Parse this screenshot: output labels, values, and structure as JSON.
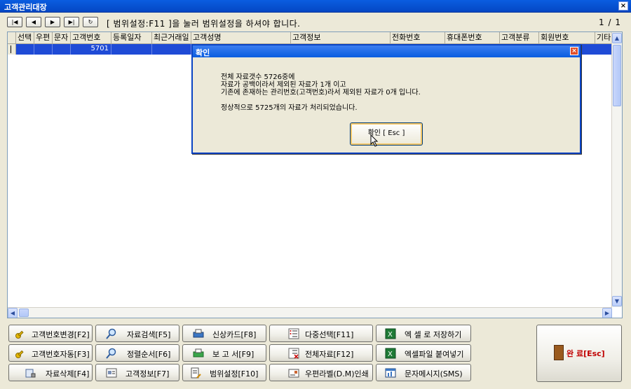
{
  "window": {
    "title": "고객관리대장",
    "close_glyph": "×"
  },
  "nav": {
    "buttons": [
      {
        "name": "first-record-button",
        "glyph": "|◀"
      },
      {
        "name": "prev-record-button",
        "glyph": "◀"
      },
      {
        "name": "next-record-button",
        "glyph": "▶"
      },
      {
        "name": "last-record-button",
        "glyph": "▶|"
      },
      {
        "name": "refresh-button",
        "glyph": "↻"
      }
    ],
    "hint": "[ 범위설정:F11 ]을 눌러 범위설정을 하셔야 합니다.",
    "page_count": "1 / 1"
  },
  "grid": {
    "columns": [
      "선택",
      "우편",
      "문자",
      "고객번호",
      "등록일자",
      "최근거래일",
      "고객성명",
      "고객정보",
      "전화번호",
      "휴대폰번호",
      "고객분류",
      "회원번호",
      "기타"
    ],
    "rows": [
      {
        "customer_no": "5701"
      }
    ]
  },
  "dialog": {
    "title": "확인",
    "close_glyph": "×",
    "lines": [
      "전체 자료갯수 5726중에",
      "자료가 공백이라서 제외된 자료가 1개 이고",
      "기존에 존재하는 관리번호(고객번호)라서 제외된 자료가 0개 입니다.",
      "정상적으로 5725개의 자료가 처리되었습니다."
    ],
    "ok_label": "확인 [ Esc ]"
  },
  "buttons": {
    "change_no": "고객번호변경[F2]",
    "search": "자료검색[F5]",
    "card": "신상카드[F8]",
    "multi_select": "다중선택[F11]",
    "excel_save": "엑 셀 로 저장하기",
    "auto_no": "고객번호자동[F3]",
    "sort": "정렬순서[F6]",
    "report": "보 고 서[F9]",
    "all_data": "전체자료[F12]",
    "excel_paste": "엑셀파일 붙여넣기",
    "delete": "자료삭제[F4]",
    "info": "고객정보[F7]",
    "range": "범위설정[F10]",
    "label_print": "우편라벨(D.M)인쇄",
    "sms": "문자메시지(SMS)",
    "done": "완 료[Esc]"
  },
  "icons": {
    "key": "key-icon",
    "search": "magnifier-icon",
    "printer": "printer-icon",
    "checklist": "checklist-icon",
    "excel": "excel-icon",
    "door": "exit-door-icon"
  },
  "colors": {
    "titlebar": "#0a5de0",
    "selection": "#1f4bd6",
    "done_text": "#c00000"
  }
}
